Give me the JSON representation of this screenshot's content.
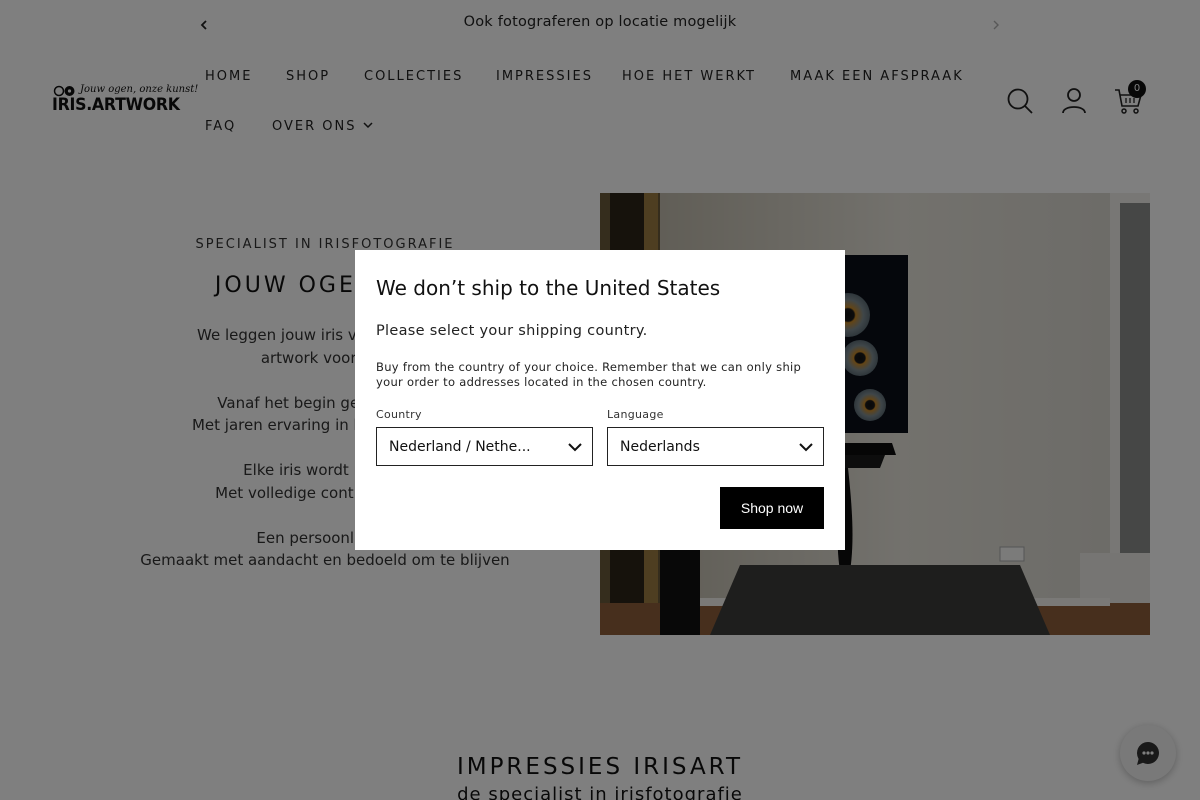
{
  "announcement": {
    "text": "Ook fotograferen op locatie mogelijk",
    "prev_icon": "chevron-left-icon",
    "next_icon": "chevron-right-icon"
  },
  "logo": {
    "tagline": "Jouw ogen, onze kunst!",
    "wordmark": "IRIS.ARTWORK"
  },
  "nav": {
    "items": [
      {
        "label": "HOME"
      },
      {
        "label": "SHOP"
      },
      {
        "label": "COLLECTIES"
      },
      {
        "label": "IMPRESSIES"
      },
      {
        "label": "HOE HET WERKT"
      },
      {
        "label": "MAAK EEN AFSPRAAK"
      },
      {
        "label": "FAQ"
      },
      {
        "label": "OVER ONS"
      }
    ]
  },
  "header_icons": {
    "search": "search-icon",
    "account": "user-icon",
    "cart": "cart-icon",
    "cart_count": "0"
  },
  "hero": {
    "eyebrow": "SPECIALIST IN IRISFOTOGRAFIE",
    "title": "JOUW OGEN, ON",
    "lines": [
      "We leggen jouw iris vast en werke",
      "artwork voor aan",
      "",
      "Vanaf het begin gespecialise",
      "Met jaren ervaring in het fotografer",
      "",
      "Elke iris wordt met de",
      "Met volledige controle op det",
      "",
      "Een persoonlijk ku",
      "Gemaakt met aandacht en bedoeld om te blijven"
    ]
  },
  "section": {
    "title": "IMPRESSIES IRISART",
    "subtitle": "de specialist in irisfotografie"
  },
  "chat": {
    "icon": "chat-icon"
  },
  "modal": {
    "title": "We don’t ship to the United States",
    "subtitle": "Please select your shipping country.",
    "note": "Buy from the country of your choice. Remember that we can only ship your order to addresses located in the chosen country.",
    "country_label": "Country",
    "country_value": "Nederland / Nethe...",
    "language_label": "Language",
    "language_value": "Nederlands",
    "button": "Shop now"
  },
  "colors": {
    "overlay": "#000000",
    "button_bg": "#000000",
    "text": "#222222"
  }
}
